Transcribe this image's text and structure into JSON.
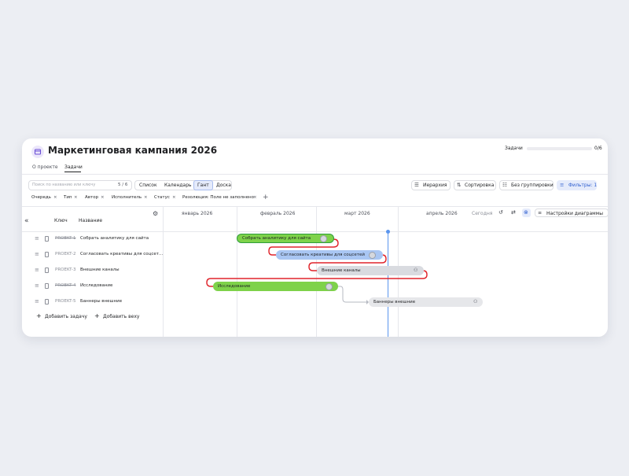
{
  "header": {
    "title": "Маркетинговая кампания 2026",
    "progress_label": "Задачи",
    "progress_count": "0/6",
    "progress_fraction": 0
  },
  "tabs": [
    {
      "label": "О проекте",
      "active": false
    },
    {
      "label": "Задачи",
      "active": true
    }
  ],
  "toolbar": {
    "search_placeholder": "Поиск по названию или ключу",
    "search_count": "5 / 6",
    "views": [
      "Список",
      "Календарь",
      "Гант",
      "Доска"
    ],
    "active_view": "Гант",
    "hierarchy_label": "Иерархия",
    "sort_label": "Сортировка",
    "group_label": "Без группировки",
    "filters_label": "Фильтры: 1"
  },
  "filter_chips": [
    "Очередь",
    "Тип",
    "Автор",
    "Исполнитель",
    "Статус",
    "Резолюция: Поле не заполнено"
  ],
  "table": {
    "headers": {
      "key": "Ключ",
      "name": "Название"
    },
    "rows": [
      {
        "key": "PROEKT-1",
        "name": "Собрать аналитику для сайта",
        "done": true
      },
      {
        "key": "PROEKT-2",
        "name": "Согласовать креативы для соцсет...",
        "done": false
      },
      {
        "key": "PROEKT-3",
        "name": "Внешние каналы",
        "done": false
      },
      {
        "key": "PROEKT-4",
        "name": "Исследование",
        "done": true
      },
      {
        "key": "PROEKT-5",
        "name": "Баннеры внешние",
        "done": false
      }
    ],
    "add_task": "Добавить задачу",
    "add_milestone": "Добавить веху"
  },
  "gantt": {
    "months": [
      "январь 2026",
      "февраль 2026",
      "март 2026",
      "апрель 2026"
    ],
    "today_label": "Сегодня",
    "settings_label": "Настройки диаграммы",
    "bars": [
      {
        "label": "Собрать аналитику для сайта",
        "color": "#7ed24a",
        "border": "#2f9e3c",
        "avatar": "photo"
      },
      {
        "label": "Согласовать креативы для соцсетей",
        "color": "#a9c6f3",
        "border": "#a9c6f3",
        "avatar": "photo"
      },
      {
        "label": "Внешние каналы",
        "color": "#d9dbe0",
        "border": "#d9dbe0",
        "avatar": "person-icon"
      },
      {
        "label": "Исследование",
        "color": "#7ed24a",
        "border": "#7ed24a",
        "avatar": "photo"
      },
      {
        "label": "Баннеры внешние",
        "color": "#e6e7ea",
        "border": "#e6e7ea",
        "avatar": "person-icon"
      }
    ],
    "link_color": "#e0242b",
    "today_color": "#5a95ee"
  }
}
